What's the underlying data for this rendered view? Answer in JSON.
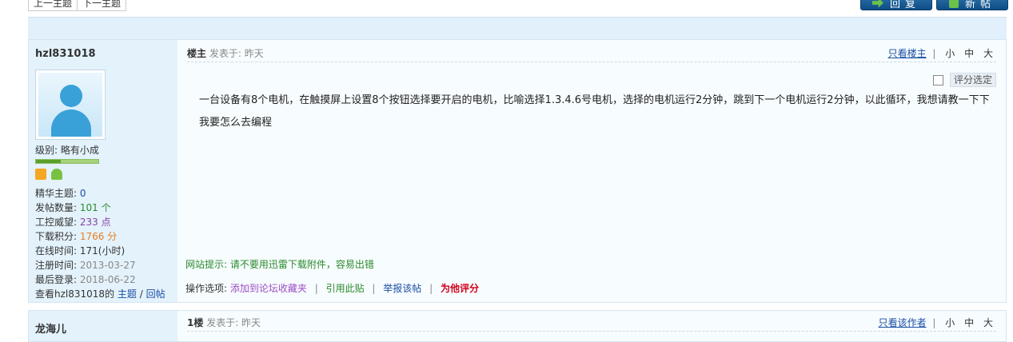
{
  "nav": {
    "prev": "上一主题",
    "next": "下一主题"
  },
  "buttons": {
    "reply": "回复",
    "new": "新帖"
  },
  "post1": {
    "username": "hzl831018",
    "level_label": "级别: 略有小成",
    "stats": [
      {
        "label": "精华主题: ",
        "value": "0",
        "color": "blue"
      },
      {
        "label": "发帖数量: ",
        "value": "101 个",
        "color": "green"
      },
      {
        "label": "工控威望: ",
        "value": "233 点",
        "color": "purple"
      },
      {
        "label": "下载积分: ",
        "value": "1766 分",
        "color": "orange"
      },
      {
        "label": "在线时间: ",
        "value": "171(小时)",
        "color": "dark"
      },
      {
        "label": "注册时间: ",
        "value": "2013-03-27",
        "color": "gray"
      },
      {
        "label": "最后登录: ",
        "value": "2018-06-22",
        "color": "gray"
      }
    ],
    "view_prefix": "查看hzl831018的",
    "view_topics": "主题",
    "view_slash": "/",
    "view_replies": "回帖",
    "floor": "楼主",
    "posted": "发表于: 昨天",
    "only_author": "只看楼主",
    "sep": "|",
    "font_small": "小",
    "font_mid": "中",
    "font_big": "大",
    "rate_label": "评分选定",
    "content": "一台设备有8个电机，在触摸屏上设置8个按钮选择要开启的电机，比喻选择1.3.4.6号电机，选择的电机运行2分钟，跳到下一个电机运行2分钟，以此循环，我想请教一下下我要怎么去编程",
    "tip": "网站提示: 请不要用迅雷下载附件，容易出错",
    "ops_label": "操作选项: ",
    "ops_fav": "添加到论坛收藏夹",
    "ops_quote": "引用此贴",
    "ops_report": "举报该帖",
    "ops_rate": "为他评分"
  },
  "post2": {
    "username": "龙海儿",
    "floor": "1楼",
    "posted": "发表于: 昨天",
    "only_author": "只看该作者",
    "sep": "|",
    "font_small": "小",
    "font_mid": "中",
    "font_big": "大"
  }
}
